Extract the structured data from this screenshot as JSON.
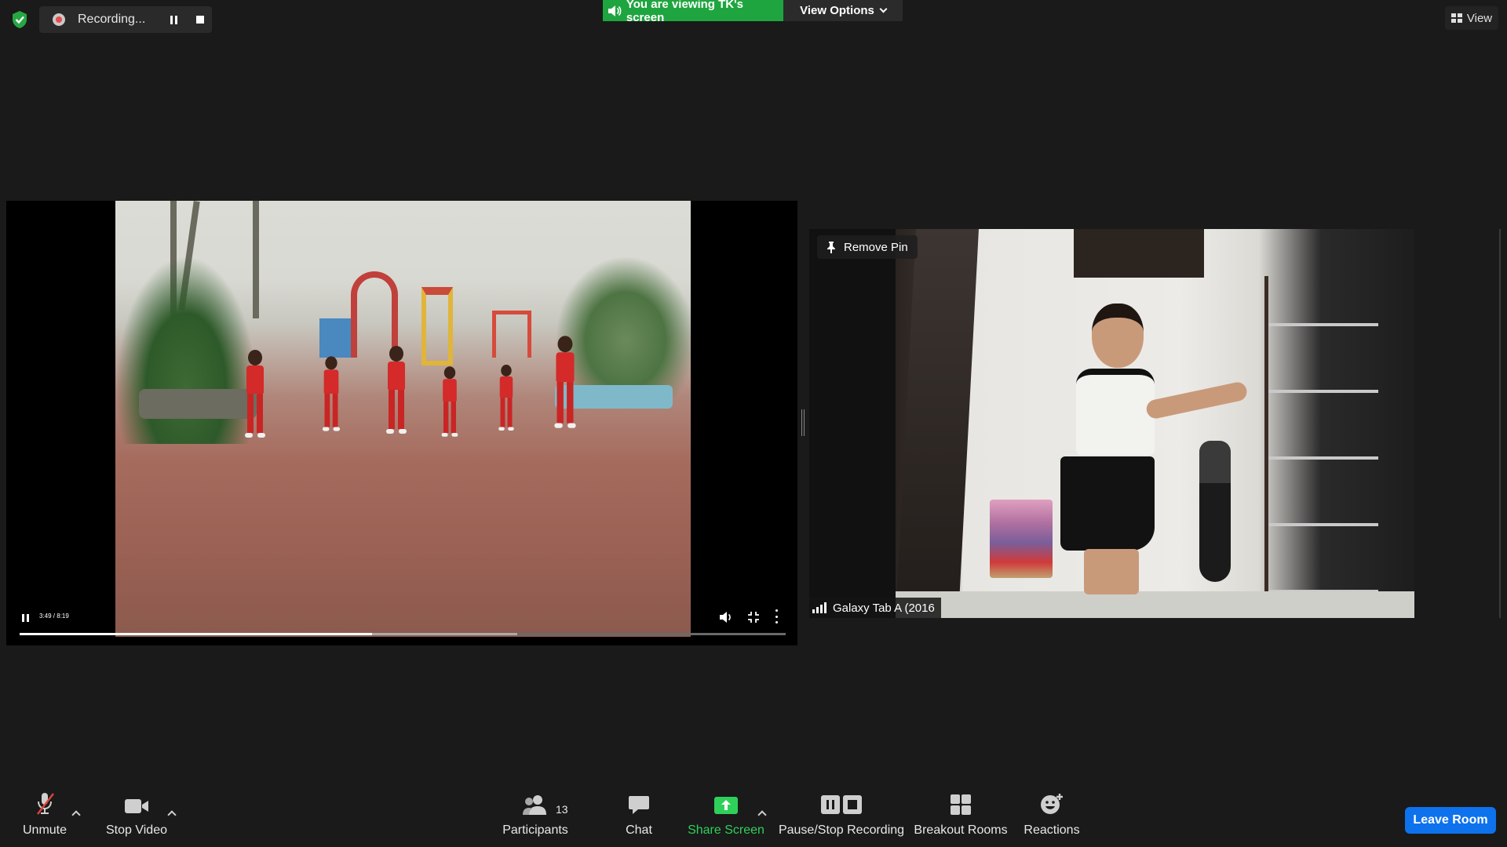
{
  "top_bar": {
    "recording": {
      "label": "Recording...",
      "pause_icon": "pause-icon",
      "stop_icon": "stop-icon"
    },
    "viewing_banner": "You are viewing TK's screen",
    "view_options_label": "View Options",
    "view_label": "View"
  },
  "shared_screen": {
    "player": {
      "time": "3:49 / 8:19",
      "progress_fraction": 0.46,
      "buffered_fraction": 0.65
    }
  },
  "pinned_participant": {
    "remove_pin_label": "Remove Pin",
    "name": "Galaxy Tab A (2016"
  },
  "toolbar": {
    "unmute_label": "Unmute",
    "stop_video_label": "Stop Video",
    "participants_label": "Participants",
    "participants_count": "13",
    "chat_label": "Chat",
    "share_screen_label": "Share Screen",
    "pause_stop_recording_label": "Pause/Stop Recording",
    "breakout_rooms_label": "Breakout Rooms",
    "reactions_label": "Reactions",
    "leave_label": "Leave Room"
  },
  "colors": {
    "background": "#1a1a1a",
    "banner_green": "#1fa53f",
    "share_green": "#2fd05a",
    "leave_blue": "#0e72ed",
    "recording_red": "#e74c4c"
  }
}
